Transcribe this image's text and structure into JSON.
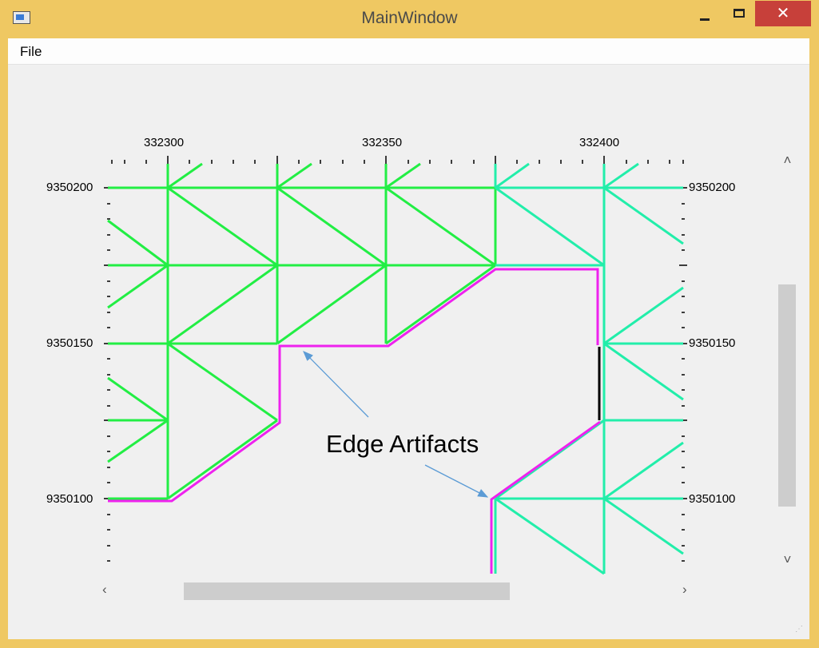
{
  "window": {
    "title": "MainWindow",
    "close_glyph": "✕"
  },
  "menu": {
    "file": "File"
  },
  "axes": {
    "x_ticks": [
      "332300",
      "332350",
      "332400"
    ],
    "y_ticks_left": [
      "9350200",
      "9350150",
      "9350100"
    ],
    "y_ticks_right": [
      "9350200",
      "9350150",
      "9350100"
    ]
  },
  "annotation": {
    "text": "Edge Artifacts"
  },
  "scrollbars": {
    "up": "˄",
    "down": "˅",
    "left": "‹",
    "right": "›"
  },
  "colors": {
    "mesh_green": "#22ee44",
    "mesh_teal": "#22eeaa",
    "edge": "#ee22ee",
    "arrow": "#5b9bd5"
  }
}
